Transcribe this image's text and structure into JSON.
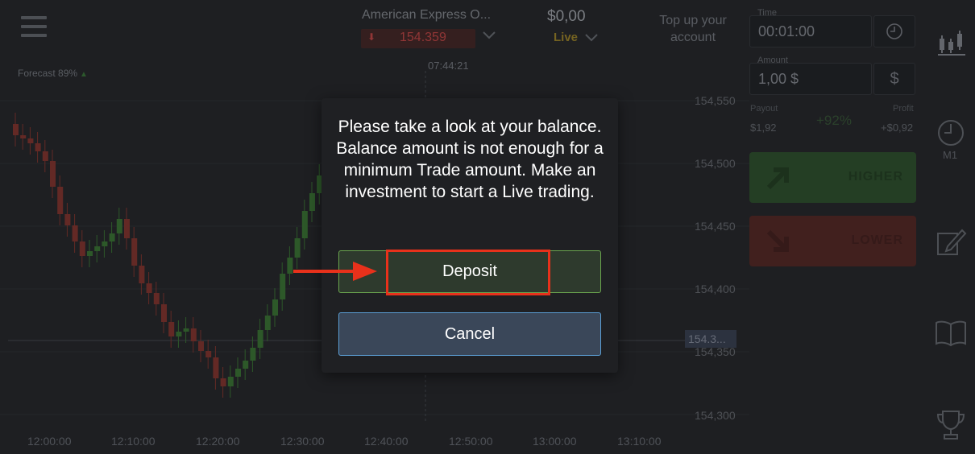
{
  "header": {
    "asset_name": "American Express O...",
    "price": "154.359",
    "balance": "$0,00",
    "account_mode": "Live",
    "topup_label": "Top up your account",
    "clock": "07:44:21",
    "forecast": "Forecast 89%"
  },
  "panel": {
    "time_label": "Time",
    "time_value": "00:01:00",
    "amount_label": "Amount",
    "amount_value": "1,00 $",
    "amount_currency_symbol": "$",
    "payout_label": "Payout",
    "payout_value": "$1,92",
    "payout_percent": "+92%",
    "profit_label": "Profit",
    "profit_value": "+$0,92",
    "higher_label": "HIGHER",
    "lower_label": "LOWER",
    "timeframe": "M1"
  },
  "chart": {
    "price_ticks": [
      "154,550",
      "154,500",
      "154,450",
      "154,400",
      "154,350",
      "154,300"
    ],
    "current_price_tag": "154.3...",
    "time_ticks": [
      "12:00:00",
      "12:10:00",
      "12:20:00",
      "12:30:00",
      "12:40:00",
      "12:50:00",
      "13:00:00",
      "13:10:00"
    ]
  },
  "modal": {
    "message": "Please take a look at your balance. Balance amount is not enough for a minimum Trade amount. Make an investment to start a Live trading.",
    "deposit_label": "Deposit",
    "cancel_label": "Cancel"
  },
  "colors": {
    "background": "#2a2c30",
    "up_candle": "#3f7a3a",
    "down_candle": "#8a3a34",
    "deposit_border": "#6aa54e",
    "cancel_border": "#5b9ed4",
    "highlight": "#e8311b"
  },
  "icons": [
    "menu-icon",
    "chevron-down-icon",
    "clock-icon",
    "dollar-icon",
    "candlestick-icon",
    "timer-icon",
    "pencil-icon",
    "book-icon",
    "trophy-icon",
    "arrow-up-right-icon",
    "arrow-down-right-icon"
  ]
}
